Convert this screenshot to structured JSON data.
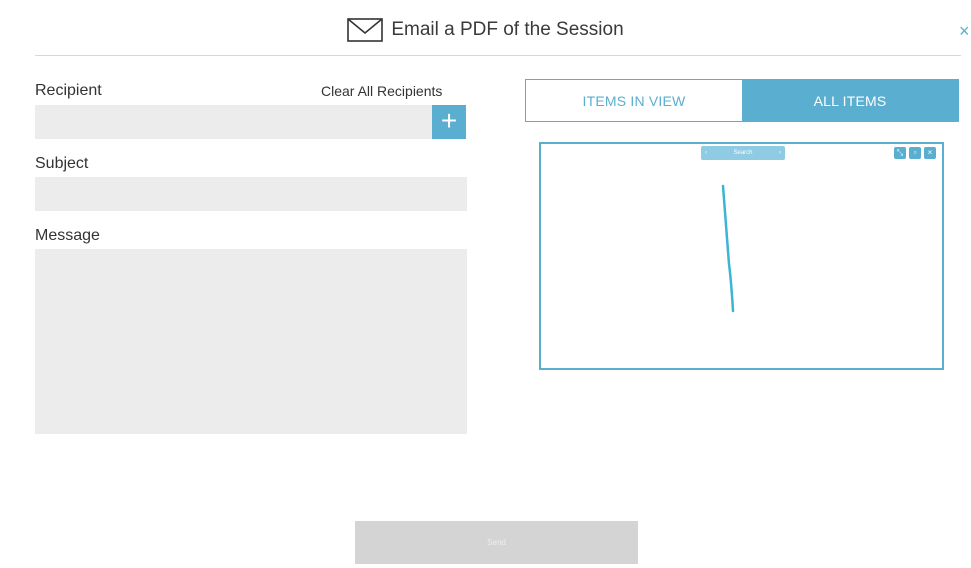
{
  "header": {
    "title": "Email a PDF of the Session",
    "icon": "envelope-icon",
    "close_label": "×"
  },
  "form": {
    "recipient_label": "Recipient",
    "clear_label": "Clear All Recipients",
    "add_label": "+",
    "subject_label": "Subject",
    "message_label": "Message",
    "recipient_value": "",
    "subject_value": "",
    "message_value": ""
  },
  "tabs": [
    {
      "label": "ITEMS IN VIEW",
      "active": false
    },
    {
      "label": "ALL ITEMS",
      "active": true
    }
  ],
  "preview": {
    "toolbar_label": "Search",
    "toolbar_left": "‹",
    "toolbar_right": "›",
    "icons": [
      "resize-icon",
      "copy-icon",
      "close-icon"
    ]
  },
  "footer": {
    "send_label": "Send"
  },
  "colors": {
    "accent": "#5aaed0",
    "input_bg": "#ececec",
    "disabled_button": "#d4d4d4"
  }
}
